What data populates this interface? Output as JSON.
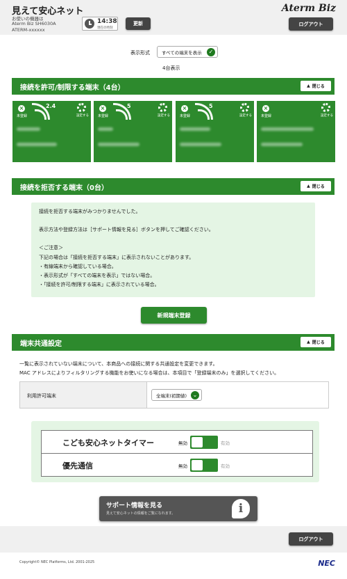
{
  "header": {
    "app_title": "見えて安心ネット",
    "device_label": "お使いの機器は",
    "device_model": "Aterm Biz SH6030A",
    "device_name": "ATERM-xxxxxx",
    "clock_time": "14:38",
    "clock_sub": "現在の時刻",
    "update_button": "更新",
    "brand": "Aterm Biz",
    "logout_button": "ログアウト"
  },
  "display": {
    "label": "表示形式",
    "selected": "すべての端末を表示",
    "count": "4台表示"
  },
  "allowed_section": {
    "title": "接続を許可/制限する端末（4台）",
    "close_label": "閉じる",
    "cards": [
      {
        "reg_label": "未登録",
        "band": "2.4",
        "settings_label": "設定する"
      },
      {
        "reg_label": "未登録",
        "band": "5",
        "settings_label": "設定する"
      },
      {
        "reg_label": "未登録",
        "band": "5",
        "settings_label": "設定する"
      },
      {
        "reg_label": "未登録",
        "band": "",
        "settings_label": "設定する"
      }
    ]
  },
  "rejected_section": {
    "title": "接続を拒否する端末（0台）",
    "close_label": "閉じる",
    "lines": [
      "接続を拒否する端末がみつかりませんでした。",
      "表示方法や登録方法は［サポート情報を見る］ボタンを押してご確認ください。",
      "＜ご注意＞",
      "下記の場合は「接続を拒否する端末」に表示されないことがあります。",
      "・有線端末から確認している場合。",
      "・表示形式が「すべての端末を表示」ではない場合。",
      "・「接続を許可/制限する端末」に表示されている場合。"
    ]
  },
  "new_device_button": "新規端末登録",
  "common_section": {
    "title": "端末共通設定",
    "close_label": "閉じる",
    "desc1": "一覧に表示されていない端末について、本商品への接続に関する共通設定を変更できます。",
    "desc2": "MAC アドレスによりフィルタリングする機能をお使いになる場合は、本項目で「登録端末のみ」を選択してください。",
    "row_label": "利用許可端末",
    "row_value": "全端末(初期値)"
  },
  "toggles": [
    {
      "label": "こども安心ネットタイマー",
      "off_label": "無効",
      "on_label": "有効"
    },
    {
      "label": "優先通信",
      "off_label": "無効",
      "on_label": "有効"
    }
  ],
  "support": {
    "title": "サポート情報を見る",
    "subtitle": "見えて安心ネットの情報をご覧になれます。",
    "icon_glyph": "i"
  },
  "footer": {
    "logout_button": "ログアウト",
    "copyright": "Copyright© NEC Platforms, Ltd. 2001-2025",
    "logo": "NEC"
  },
  "colors": {
    "accent": "#2d8a2d",
    "panel": "#e4f5e4",
    "dark_button": "#444444"
  }
}
